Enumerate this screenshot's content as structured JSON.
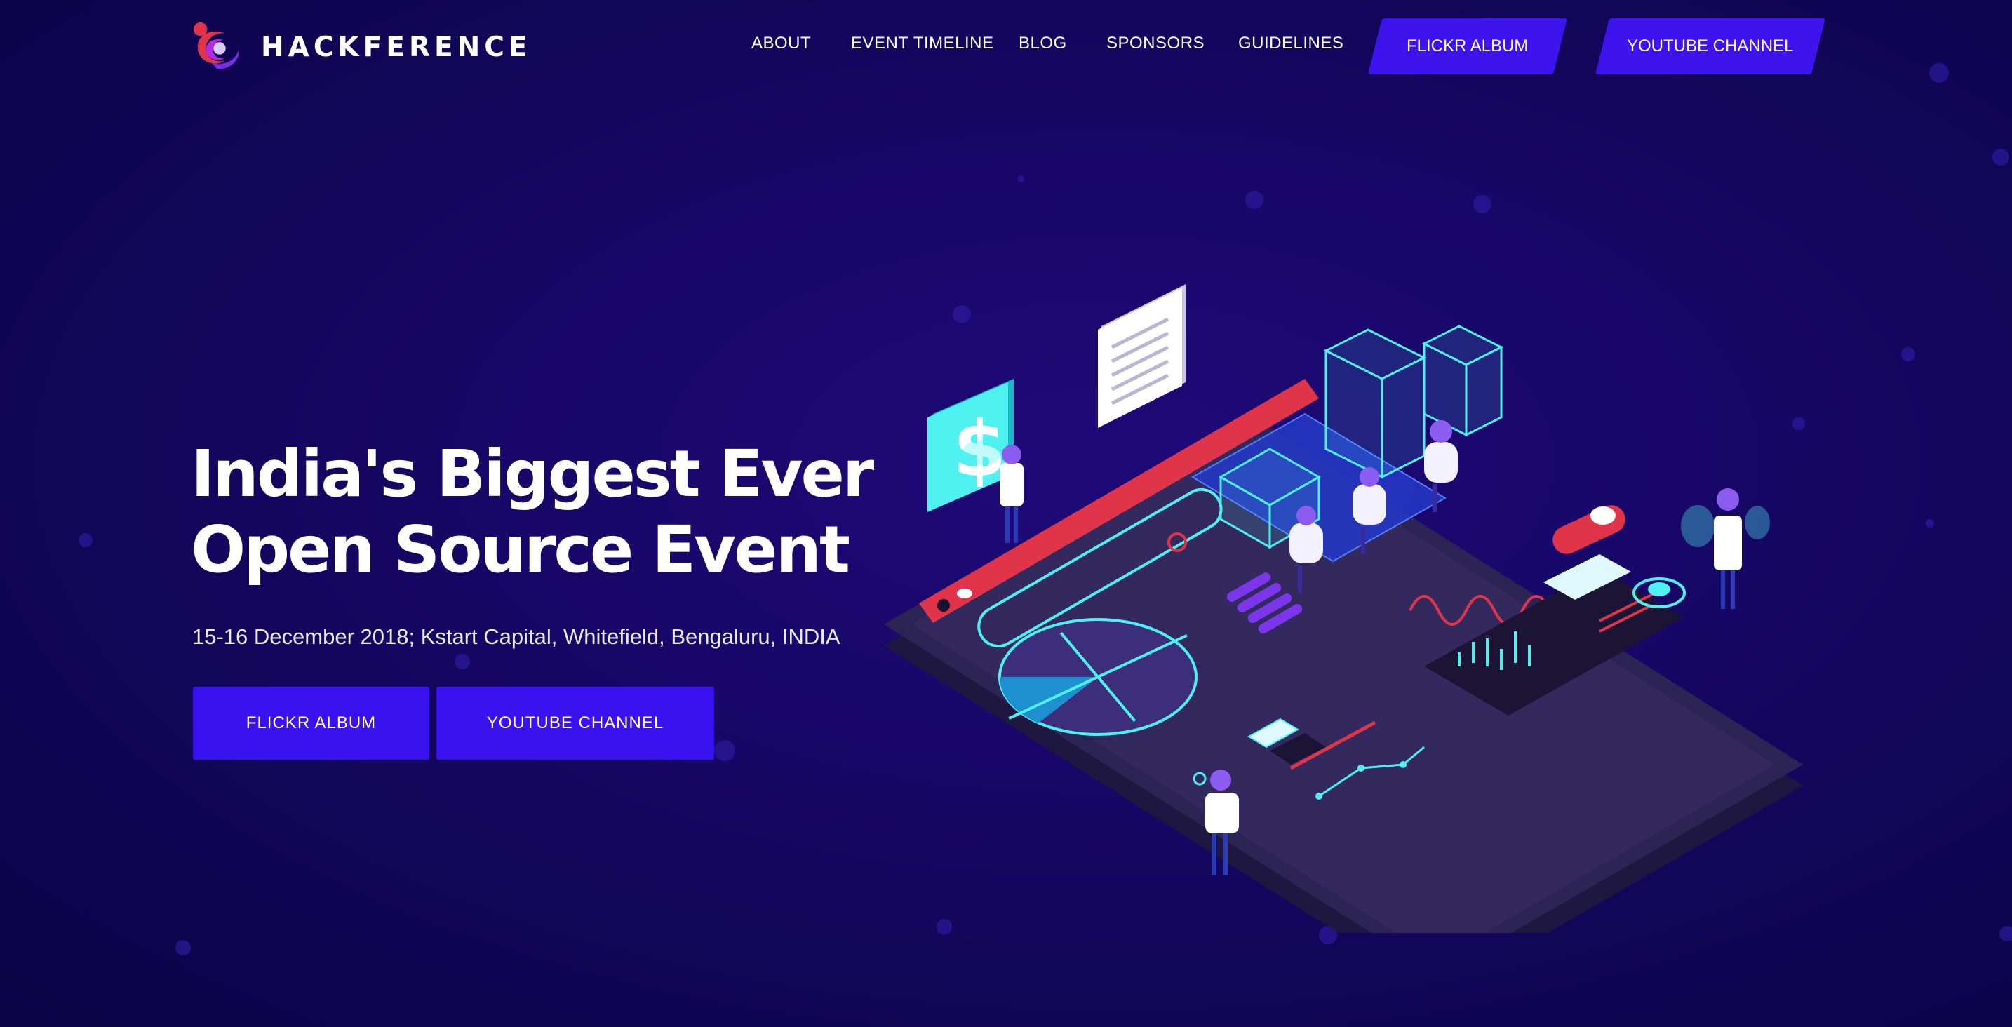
{
  "brand": {
    "name": "HACKFERENCE"
  },
  "nav": {
    "links": [
      "ABOUT",
      "EVENT TIMELINE",
      "BLOG",
      "SPONSORS",
      "GUIDELINES"
    ],
    "buttons": [
      "FLICKR ALBUM",
      "YOUTUBE CHANNEL"
    ]
  },
  "hero": {
    "title_line1": "India's Biggest Ever",
    "title_line2": "Open Source Event",
    "subtitle": "15-16 December 2018; Kstart Capital, Whitefield, Bengaluru, INDIA",
    "cta_primary": "FLICKR ALBUM",
    "cta_secondary": "YOUTUBE CHANNEL",
    "dollar_symbol": "$"
  },
  "colors": {
    "background": "#140660",
    "accent": "#3a12f0",
    "cyan": "#4ff0f0",
    "red": "#e0344a",
    "platform": "#2b2353"
  }
}
